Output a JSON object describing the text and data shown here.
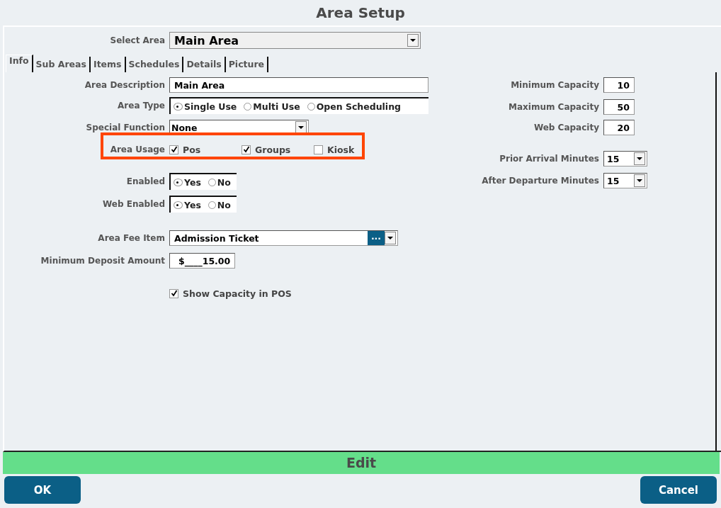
{
  "title": "Area Setup",
  "select_area": {
    "label": "Select Area",
    "value": "Main Area"
  },
  "tabs": [
    {
      "label": "Info",
      "selected": true
    },
    {
      "label": "Sub Areas",
      "selected": false
    },
    {
      "label": "Items",
      "selected": false
    },
    {
      "label": "Schedules",
      "selected": false
    },
    {
      "label": "Details",
      "selected": false
    },
    {
      "label": "Picture",
      "selected": false
    }
  ],
  "left_fields": [
    {
      "kind": "text",
      "label": "Area Description",
      "value": "Main Area"
    },
    {
      "kind": "radio",
      "label": "Area Type",
      "options": [
        {
          "label": "Single Use",
          "selected": true
        },
        {
          "label": "Multi Use",
          "selected": false
        },
        {
          "label": "Open Scheduling",
          "selected": false
        }
      ]
    },
    {
      "kind": "select",
      "label": "Special Function",
      "value": "None"
    },
    {
      "kind": "checks",
      "label": "Area Usage",
      "highlighted": true,
      "options": [
        {
          "label": "Pos",
          "checked": true
        },
        {
          "label": "Groups",
          "checked": true
        },
        {
          "label": "Kiosk",
          "checked": false
        }
      ]
    },
    {
      "kind": "radio",
      "label": "Enabled",
      "options": [
        {
          "label": "Yes",
          "selected": true
        },
        {
          "label": "No",
          "selected": false
        }
      ]
    },
    {
      "kind": "radio",
      "label": "Web Enabled",
      "options": [
        {
          "label": "Yes",
          "selected": true
        },
        {
          "label": "No",
          "selected": false
        }
      ]
    },
    {
      "kind": "lookup",
      "label": "Area Fee Item",
      "value": "Admission Ticket",
      "button": "..."
    },
    {
      "kind": "money",
      "label": "Minimum Deposit Amount",
      "value": "$____15.00"
    },
    {
      "kind": "checkbox",
      "label": "Show Capacity in POS",
      "checked": true
    }
  ],
  "right_fields": [
    {
      "kind": "number",
      "label": "Minimum Capacity",
      "value": "10"
    },
    {
      "kind": "number",
      "label": "Maximum Capacity",
      "value": "50"
    },
    {
      "kind": "number",
      "label": "Web Capacity",
      "value": "20"
    },
    {
      "kind": "select",
      "label": "Prior Arrival Minutes",
      "value": "15"
    },
    {
      "kind": "select",
      "label": "After Departure Minutes",
      "value": "15"
    }
  ],
  "mode": "Edit",
  "buttons": [
    {
      "label": "OK"
    },
    {
      "label": "Cancel"
    }
  ]
}
